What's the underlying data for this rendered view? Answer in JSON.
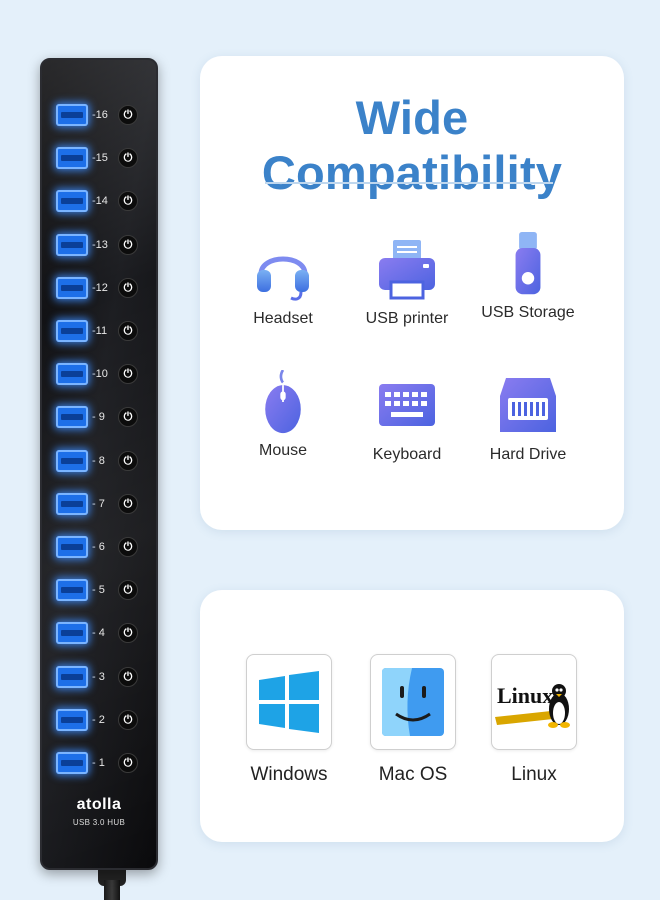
{
  "hub": {
    "brand": "atolla",
    "model": "USB 3.0 HUB",
    "ports": [
      "-16",
      "-15",
      "-14",
      "-13",
      "-12",
      "-11",
      "-10",
      "- 9",
      "- 8",
      "- 7",
      "- 6",
      "- 5",
      "- 4",
      "- 3",
      "- 2",
      "- 1"
    ],
    "power_symbol": "⏻",
    "port_color": "#1d6fe8"
  },
  "compatibility": {
    "title": "Wide Compatibility",
    "title_color": "#3b82c9",
    "devices": [
      {
        "label": "Headset",
        "icon": "headset-icon"
      },
      {
        "label": "USB printer",
        "icon": "printer-icon"
      },
      {
        "label": "USB Storage",
        "icon": "usb-storage-icon"
      },
      {
        "label": "Mouse",
        "icon": "mouse-icon"
      },
      {
        "label": "Keyboard",
        "icon": "keyboard-icon"
      },
      {
        "label": "Hard Drive",
        "icon": "hard-drive-icon"
      }
    ]
  },
  "os": {
    "items": [
      {
        "label": "Windows",
        "icon": "windows-logo-icon"
      },
      {
        "label": "Mac OS",
        "icon": "mac-finder-icon"
      },
      {
        "label": "Linux",
        "icon": "linux-logo-icon",
        "logo_text": "Linux"
      }
    ]
  }
}
